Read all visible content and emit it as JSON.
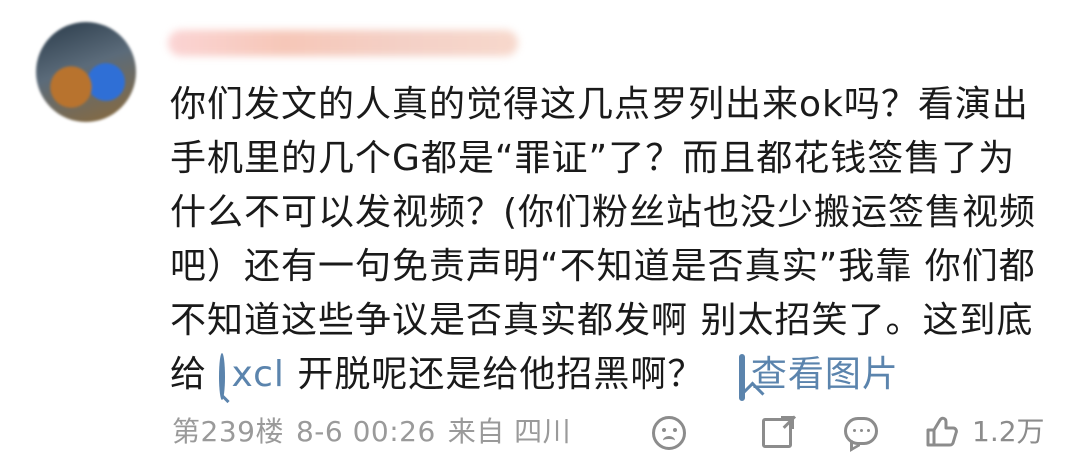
{
  "comment": {
    "body": "你们发文的人真的觉得这几点罗列出来ok吗？看演出手机里的几个G都是“罪证”了？而且都花钱签售了为什么不可以发视频？(你们粉丝站也没少搬运签售视频吧）还有一句免责声明“不知道是否真实”我靠 你们都不知道这些争议是否真实都发啊 别太招笑了。这到底给",
    "link_text": "xcl",
    "body_tail": "开脱呢还是给他招黑啊？",
    "view_image_label": "查看图片"
  },
  "footer": {
    "floor": "第239楼",
    "time": "8-6 00:26",
    "location": "来自 四川",
    "like_count": "1.2万"
  },
  "icons": {
    "search": "search-icon",
    "image": "image-icon",
    "dislike": "dislike-face-icon",
    "share": "share-icon",
    "comment": "comment-icon",
    "like": "thumbs-up-icon"
  },
  "colors": {
    "link": "#5b84ad",
    "meta": "#9a9a9a",
    "text": "#1a1a1a"
  }
}
